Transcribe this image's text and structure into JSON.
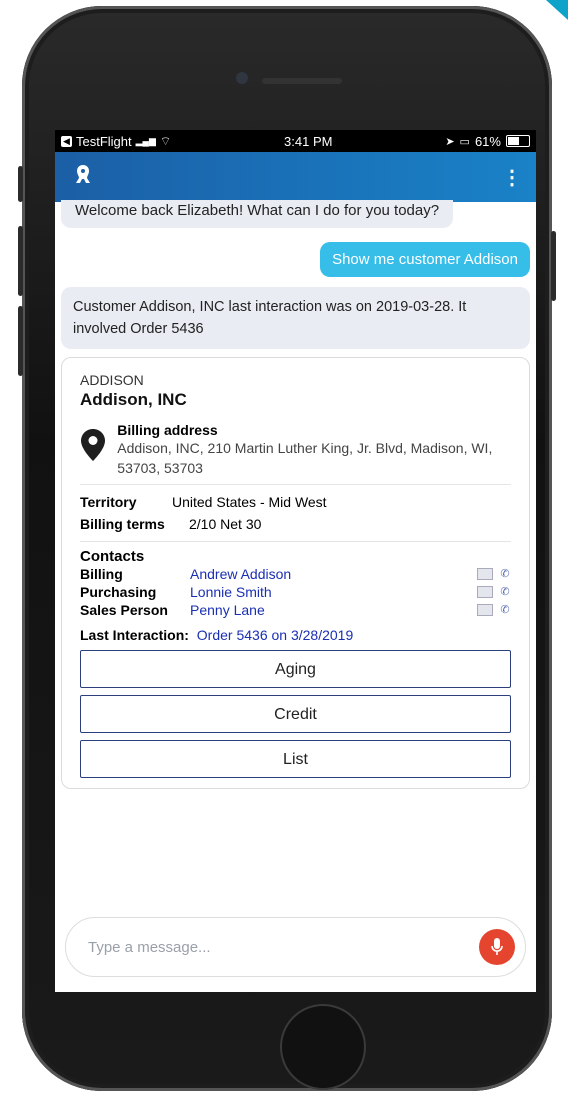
{
  "status_bar": {
    "app": "TestFlight",
    "time": "3:41 PM",
    "battery": "61%",
    "battery_level": 0.61
  },
  "chat": {
    "welcome": "Welcome back Elizabeth! What can I do for you today?",
    "user_message": "Show me customer Addison",
    "bot_reply": "Customer Addison, INC last interaction was on 2019-03-28. It involved Order 5436"
  },
  "customer": {
    "code": "ADDISON",
    "name": "Addison, INC",
    "billing_label": "Billing address",
    "billing_address": "Addison, INC, 210 Martin Luther King, Jr. Blvd, Madison, WI, 53703, 53703",
    "territory_label": "Territory",
    "territory": "United States - Mid West",
    "terms_label": "Billing terms",
    "terms": "2/10 Net 30",
    "contacts_title": "Contacts",
    "contacts": [
      {
        "role": "Billing",
        "name": "Andrew Addison"
      },
      {
        "role": "Purchasing",
        "name": "Lonnie Smith"
      },
      {
        "role": "Sales Person",
        "name": "Penny Lane"
      }
    ],
    "last_interaction_label": "Last Interaction:",
    "last_interaction": "Order 5436 on 3/28/2019"
  },
  "actions": {
    "aging": "Aging",
    "credit": "Credit",
    "list": "List"
  },
  "composer": {
    "placeholder": "Type a message..."
  },
  "colors": {
    "header": "#1a6fb8",
    "user_bubble": "#36bde8",
    "link": "#1a2fb3",
    "mic": "#e5452e"
  },
  "icons": {
    "logo": "bot-logo-icon",
    "menu": "more-vertical-icon",
    "pin": "map-pin-icon",
    "mail": "mail-icon",
    "phone": "phone-icon",
    "mic": "microphone-icon"
  }
}
